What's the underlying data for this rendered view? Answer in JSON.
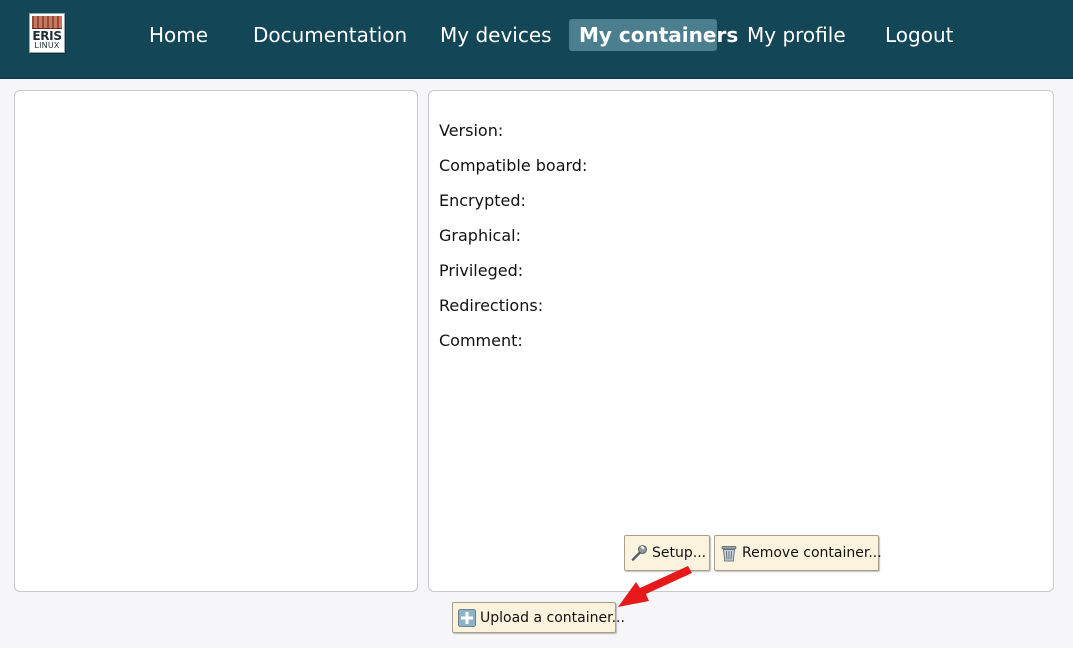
{
  "brand": {
    "logo_top": "ERIS",
    "logo_bottom": "LINUX"
  },
  "nav": {
    "home": "Home",
    "documentation": "Documentation",
    "devices": "My devices",
    "containers": "My containers",
    "profile": "My profile",
    "logout": "Logout"
  },
  "details": {
    "version": "Version:",
    "compatible_board": "Compatible board:",
    "encrypted": "Encrypted:",
    "graphical": "Graphical:",
    "privileged": "Privileged:",
    "redirections": "Redirections:",
    "comment": "Comment:"
  },
  "actions": {
    "setup_label": "Setup...",
    "remove_label": "Remove container...",
    "upload_label": "Upload a container..."
  },
  "icons": {
    "setup": "wrench-icon",
    "remove": "trash-icon",
    "upload": "plus-icon",
    "annotation": "red-arrow-icon"
  },
  "colors": {
    "header_bg": "#134656",
    "active_tab_bg": "#4b7f8f",
    "button_bg": "#fcf3df",
    "arrow": "#e8191a"
  }
}
